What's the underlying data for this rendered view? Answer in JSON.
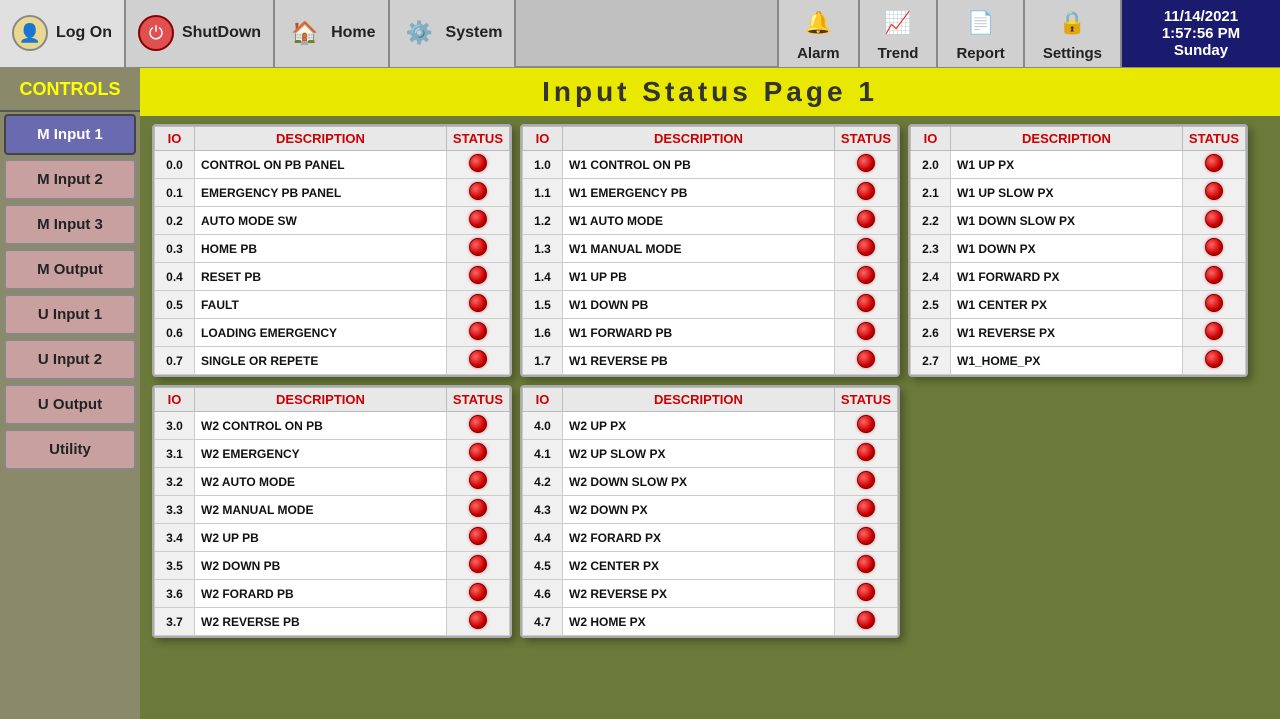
{
  "header": {
    "logon_label": "Log On",
    "shutdown_label": "ShutDown",
    "home_label": "Home",
    "system_label": "System",
    "alarm_label": "Alarm",
    "trend_label": "Trend",
    "report_label": "Report",
    "settings_label": "Settings",
    "datetime": "11/14/2021",
    "time": "1:57:56 PM",
    "day": "Sunday"
  },
  "sidebar": {
    "title": "CONTROLS",
    "items": [
      {
        "label": "M Input 1",
        "active": true
      },
      {
        "label": "M Input 2",
        "active": false
      },
      {
        "label": "M Input 3",
        "active": false
      },
      {
        "label": "M Output",
        "active": false
      },
      {
        "label": "U Input 1",
        "active": false
      },
      {
        "label": "U Input 2",
        "active": false
      },
      {
        "label": "U Output",
        "active": false
      },
      {
        "label": "Utility",
        "active": false
      }
    ]
  },
  "page_title": "Input  Status  Page  1",
  "tables": {
    "table1": {
      "headers": [
        "IO",
        "DESCRIPTION",
        "STATUS"
      ],
      "rows": [
        {
          "io": "0.0",
          "desc": "CONTROL ON PB PANEL"
        },
        {
          "io": "0.1",
          "desc": "EMERGENCY PB PANEL"
        },
        {
          "io": "0.2",
          "desc": "AUTO MODE SW"
        },
        {
          "io": "0.3",
          "desc": "HOME PB"
        },
        {
          "io": "0.4",
          "desc": "RESET PB"
        },
        {
          "io": "0.5",
          "desc": "FAULT"
        },
        {
          "io": "0.6",
          "desc": "LOADING EMERGENCY"
        },
        {
          "io": "0.7",
          "desc": "SINGLE OR REPETE"
        }
      ]
    },
    "table2": {
      "headers": [
        "IO",
        "DESCRIPTION",
        "STATUS"
      ],
      "rows": [
        {
          "io": "1.0",
          "desc": "W1 CONTROL ON PB"
        },
        {
          "io": "1.1",
          "desc": "W1 EMERGENCY PB"
        },
        {
          "io": "1.2",
          "desc": "W1 AUTO MODE"
        },
        {
          "io": "1.3",
          "desc": "W1 MANUAL MODE"
        },
        {
          "io": "1.4",
          "desc": "W1 UP PB"
        },
        {
          "io": "1.5",
          "desc": "W1 DOWN PB"
        },
        {
          "io": "1.6",
          "desc": "W1 FORWARD PB"
        },
        {
          "io": "1.7",
          "desc": "W1 REVERSE PB"
        }
      ]
    },
    "table3": {
      "headers": [
        "IO",
        "DESCRIPTION",
        "STATUS"
      ],
      "rows": [
        {
          "io": "2.0",
          "desc": "W1 UP PX"
        },
        {
          "io": "2.1",
          "desc": "W1 UP SLOW PX"
        },
        {
          "io": "2.2",
          "desc": "W1 DOWN SLOW PX"
        },
        {
          "io": "2.3",
          "desc": "W1 DOWN PX"
        },
        {
          "io": "2.4",
          "desc": "W1 FORWARD PX"
        },
        {
          "io": "2.5",
          "desc": "W1 CENTER PX"
        },
        {
          "io": "2.6",
          "desc": "W1 REVERSE PX"
        },
        {
          "io": "2.7",
          "desc": "W1_HOME_PX"
        }
      ]
    },
    "table4": {
      "headers": [
        "IO",
        "DESCRIPTION",
        "STATUS"
      ],
      "rows": [
        {
          "io": "3.0",
          "desc": "W2 CONTROL ON PB"
        },
        {
          "io": "3.1",
          "desc": "W2 EMERGENCY"
        },
        {
          "io": "3.2",
          "desc": "W2 AUTO MODE"
        },
        {
          "io": "3.3",
          "desc": "W2 MANUAL MODE"
        },
        {
          "io": "3.4",
          "desc": "W2 UP PB"
        },
        {
          "io": "3.5",
          "desc": "W2 DOWN PB"
        },
        {
          "io": "3.6",
          "desc": "W2 FORARD PB"
        },
        {
          "io": "3.7",
          "desc": "W2 REVERSE PB"
        }
      ]
    },
    "table5": {
      "headers": [
        "IO",
        "DESCRIPTION",
        "STATUS"
      ],
      "rows": [
        {
          "io": "4.0",
          "desc": "W2 UP PX"
        },
        {
          "io": "4.1",
          "desc": "W2 UP SLOW PX"
        },
        {
          "io": "4.2",
          "desc": "W2 DOWN SLOW PX"
        },
        {
          "io": "4.3",
          "desc": "W2 DOWN PX"
        },
        {
          "io": "4.4",
          "desc": "W2 FORARD PX"
        },
        {
          "io": "4.5",
          "desc": "W2 CENTER PX"
        },
        {
          "io": "4.6",
          "desc": "W2 REVERSE PX"
        },
        {
          "io": "4.7",
          "desc": "W2 HOME PX"
        }
      ]
    }
  }
}
